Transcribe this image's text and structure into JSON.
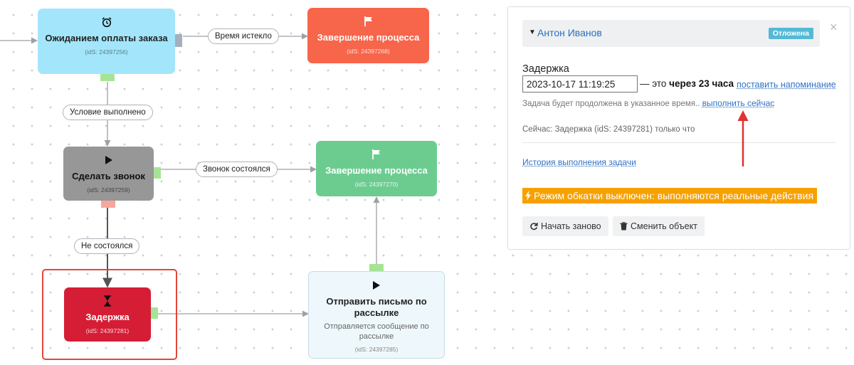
{
  "nodes": {
    "wait_payment": {
      "title": "Ожиданием оплаты заказа",
      "ids": "(idS: 24397256)",
      "icon": "alarm-clock-icon"
    },
    "end_process_1": {
      "title": "Завершение процесса",
      "ids": "(idS: 24397268)",
      "icon": "flag-icon"
    },
    "make_call": {
      "title": "Сделать звонок",
      "ids": "(idS: 24397259)",
      "icon": "play-icon"
    },
    "end_process_2": {
      "title": "Завершение процесса",
      "ids": "(idS: 24397270)",
      "icon": "flag-icon"
    },
    "delay": {
      "title": "Задержка",
      "ids": "(idS: 24397281)",
      "icon": "hourglass-icon"
    },
    "send_email": {
      "title": "Отправить письмо по рассылке",
      "subtitle": "Отправляется сообщение по рассылке",
      "ids": "(idS: 24397285)",
      "icon": "play-icon"
    }
  },
  "edges": {
    "time_expired": "Время истекло",
    "condition_met": "Условие выполнено",
    "call_happened": "Звонок состоялся",
    "not_happened": "Не состоялся"
  },
  "colors": {
    "cyan": "#a3e6fb",
    "orange": "#f7654b",
    "grey": "#979797",
    "green": "#6ccc90",
    "red": "#d51d35",
    "selection": "#e2473b",
    "banner": "#f7a100",
    "link": "#3072c4",
    "badge": "#54b9d6"
  },
  "panel": {
    "person": "Антон Иванов",
    "status_badge": "Отложена",
    "close": "×",
    "delay_title": "Задержка",
    "datetime_value": "2023-10-17 11:19:25",
    "relative_prefix": "— это",
    "relative_value": "через 23 часа",
    "remind_link": "поставить напоминание",
    "hint_text": "Задача будет продолжена в указанное время..",
    "run_now_link": "выполнить сейчас",
    "now_status": "Сейчас: Задержка (idS: 24397281) только что",
    "history_link": "История выполнения задачи",
    "mode_banner": "Режим обкатки выключен: выполняются реальные действия",
    "restart_button": "Начать заново",
    "change_object_button": "Сменить объект",
    "icons": [
      "caret-down-icon",
      "bolt-icon",
      "refresh-icon",
      "trash-icon"
    ]
  }
}
